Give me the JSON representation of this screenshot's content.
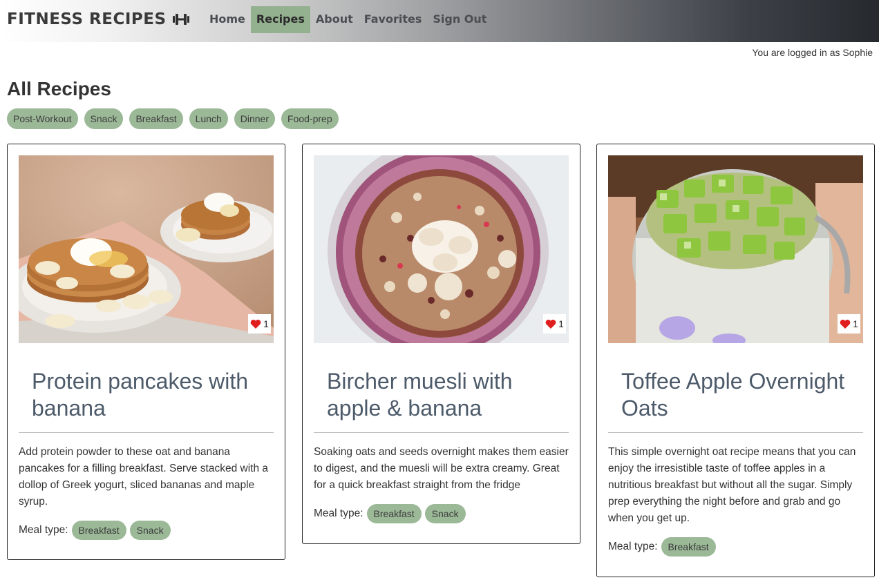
{
  "header": {
    "brand": "FITNESS RECIPES",
    "brand_icon": "dumbbell-icon",
    "nav": [
      {
        "label": "Home",
        "active": false
      },
      {
        "label": "Recipes",
        "active": true
      },
      {
        "label": "About",
        "active": false
      },
      {
        "label": "Favorites",
        "active": false
      },
      {
        "label": "Sign Out",
        "active": false
      }
    ]
  },
  "login_status": "You are logged in as Sophie",
  "page": {
    "title": "All Recipes",
    "filters": [
      "Post-Workout",
      "Snack",
      "Breakfast",
      "Lunch",
      "Dinner",
      "Food-prep"
    ]
  },
  "recipes": [
    {
      "title": "Protein pancakes with banana",
      "likes": "1",
      "description": "Add protein powder to these oat and banana pancakes for a filling breakfast. Serve stacked with a dollop of Greek yogurt, sliced bananas and maple syrup.",
      "meal_type_label": "Meal type:",
      "meal_types": [
        "Breakfast",
        "Snack"
      ]
    },
    {
      "title": "Bircher muesli with apple & banana",
      "likes": "1",
      "description": "Soaking oats and seeds overnight makes them easier to digest, and the muesli will be extra creamy. Great for a quick breakfast straight from the fridge",
      "meal_type_label": "Meal type:",
      "meal_types": [
        "Breakfast",
        "Snack"
      ]
    },
    {
      "title": "Toffee Apple Overnight Oats",
      "likes": "1",
      "description": "This simple overnight oat recipe means that you can enjoy the irresistible taste of toffee apples in a nutritious breakfast but without all the sugar. Simply prep everything the night before and grab and go when you get up.",
      "meal_type_label": "Meal type:",
      "meal_types": [
        "Breakfast"
      ]
    }
  ],
  "colors": {
    "accent_green": "#93b08f",
    "pill_green": "#9bb897",
    "heart_red": "#e01e1e",
    "title_slate": "#4c5a6a"
  }
}
